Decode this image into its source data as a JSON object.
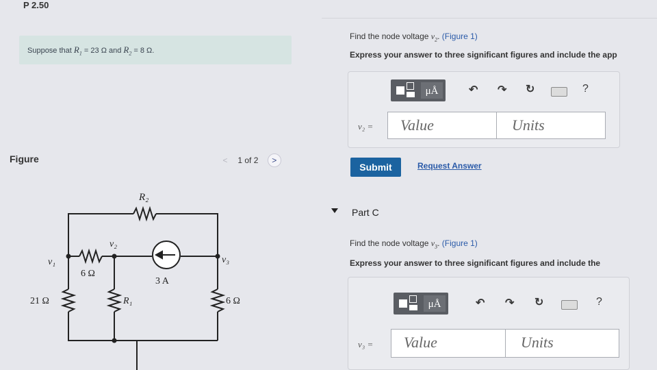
{
  "page": {
    "title": "P 2.50"
  },
  "problem": {
    "assumption_prefix": "Suppose that",
    "r1_sym": "R",
    "r1_sub": "1",
    "r1_value": "= 23 Ω and",
    "r2_sym": "R",
    "r2_sub": "2",
    "r2_value": "= 8 Ω."
  },
  "figure": {
    "label": "Figure",
    "pager_text": "1 of 2",
    "prev_icon": "chevron-left-icon",
    "next_icon": "chevron-right-icon"
  },
  "part_b": {
    "question_prefix": "Find the node voltage",
    "variable": "v",
    "variable_sub": "2",
    "question_suffix": ". (Figure 1)",
    "figure_link": "(Figure 1)",
    "instruction": "Express your answer to three significant figures and include the app",
    "var_label": "v₂ =",
    "value_placeholder": "Value",
    "units_placeholder": "Units",
    "submit_label": "Submit",
    "request_answer_label": "Request Answer",
    "toolbar_unit_label": "μÅ",
    "help_label": "?"
  },
  "part_c": {
    "title": "Part C",
    "question_prefix": "Find the node voltage",
    "variable": "v",
    "variable_sub": "3",
    "figure_link": "(Figure 1)",
    "instruction": "Express your answer to three significant figures and include the",
    "var_label": "v₃ =",
    "value_placeholder": "Value",
    "units_placeholder": "Units",
    "toolbar_unit_label": "μÅ",
    "help_label": "?"
  },
  "circuit": {
    "r2_label": "R₂",
    "v1_label": "v₁",
    "v2_label": "v₂",
    "v3_label": "v₃",
    "r_6ohm_top_label": "6 Ω",
    "source_label": "3 A",
    "r_21ohm_label": "21 Ω",
    "r1_label": "R₁",
    "r_6ohm_right_label": "6 Ω"
  },
  "colors": {
    "accent": "#1b63a0",
    "link": "#2a5aa8",
    "assumption_bg": "#d6e4e2"
  }
}
